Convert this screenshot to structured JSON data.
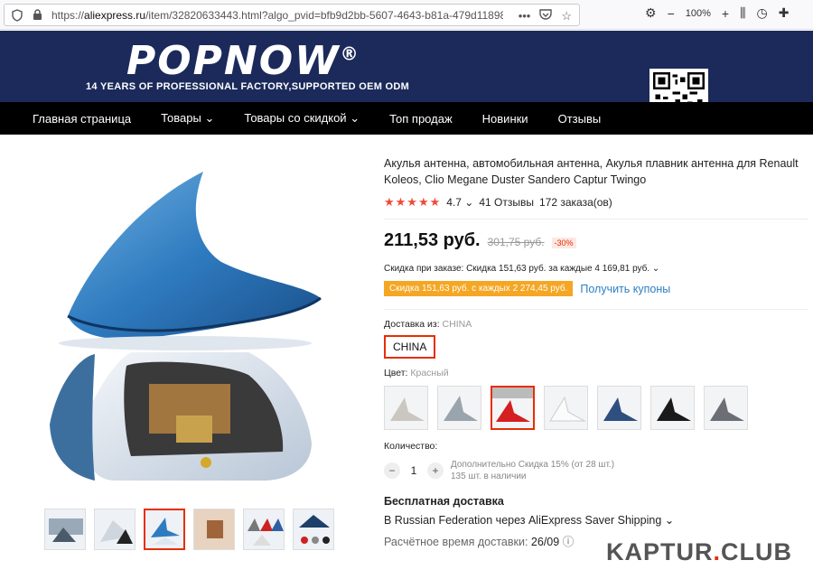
{
  "browser": {
    "url_prefix": "https://",
    "url_domain": "aliexpress.ru",
    "url_rest": "/item/32820633443.html?algo_pvid=bfb9d2bb-5607-4643-b81a-479d118987",
    "zoom": "100%"
  },
  "banner": {
    "logo": "POPNOW",
    "registered": "®",
    "tagline": "14 YEARS OF PROFESSIONAL FACTORY,SUPPORTED OEM  ODM"
  },
  "nav": {
    "items": [
      "Главная страница",
      "Товары",
      "Товары со скидкой",
      "Топ продаж",
      "Новинки",
      "Отзывы"
    ]
  },
  "product": {
    "title": "Акулья антенна, автомобильная антенна, Акулья плавник антенна для Renault Koleos, Clio Megane Duster Sandero Captur Twingo",
    "rating": "4.7",
    "reviews": "41 Отзывы",
    "orders": "172 заказа(ов)",
    "price": "211,53 руб.",
    "old_price": "301,75 руб.",
    "discount": "-30%",
    "order_discount": "Скидка при заказе: Скидка 151,63 руб. за каждые 4 169,81 руб.",
    "coupon_badge": "Скидка 151,63 руб. с каждых 2 274,45 руб.",
    "coupon_link": "Получить купоны",
    "ship_from_label": "Доставка из:",
    "ship_from_value": "CHINA",
    "ship_option": "CHINA",
    "color_label": "Цвет:",
    "color_value": "Красный",
    "qty_label": "Количество:",
    "qty": "1",
    "qty_note1": "Дополнительно Скидка 15% (от 28 шт.)",
    "qty_note2": "135 шт. в наличии",
    "free_shipping": "Бесплатная доставка",
    "ship_via": "В Russian Federation через AliExpress Saver Shipping",
    "eta_label": "Расчётное время доставки:",
    "eta_value": "26/09"
  },
  "colors": {
    "accent": "#e62e04",
    "banner": "#1b2a5a",
    "link": "#2c7fc2",
    "coupon": "#f5a623",
    "swatches": [
      "#c9c7c0",
      "#9aa4ad",
      "#d42020",
      "#f4f4f4",
      "#2f4f80",
      "#1a1a1a",
      "#6b6f75"
    ]
  },
  "watermark": {
    "left": "KAPTUR",
    "dot": ".",
    "right": "CLUB"
  }
}
